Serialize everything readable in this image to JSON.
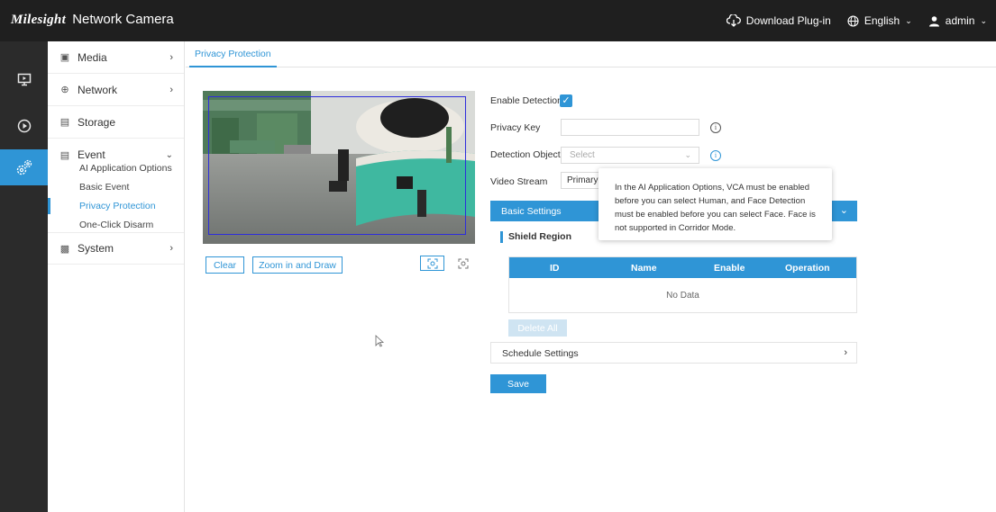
{
  "header": {
    "brand": "Milesight",
    "product": "Network Camera",
    "download_label": "Download Plug-in",
    "language": "English",
    "user": "admin"
  },
  "rail": [
    {
      "icon": "live-view-icon"
    },
    {
      "icon": "playback-icon"
    },
    {
      "icon": "settings-icon",
      "active": true
    }
  ],
  "sidebar": {
    "items": [
      {
        "label": "Media",
        "icon": "media-icon"
      },
      {
        "label": "Network",
        "icon": "globe-icon"
      },
      {
        "label": "Storage",
        "icon": "storage-icon"
      },
      {
        "label": "Event",
        "icon": "event-icon"
      },
      {
        "label": "System",
        "icon": "system-icon"
      }
    ],
    "event_sub": [
      "AI Application Options",
      "Basic Event",
      "Privacy Protection",
      "One-Click Disarm"
    ],
    "active_sub": "Privacy Protection"
  },
  "tab": "Privacy Protection",
  "preview": {
    "buttons": {
      "clear": "Clear",
      "zoom": "Zoom in and Draw"
    }
  },
  "form": {
    "enable_detection": "Enable Detection",
    "enable_checked": true,
    "privacy_key": "Privacy Key",
    "privacy_key_value": "",
    "detection_object": "Detection Object",
    "detection_placeholder": "Select",
    "video_stream": "Video Stream",
    "video_stream_value": "Primary Stream"
  },
  "tooltip": "In the AI Application Options, VCA must be enabled before you can select Human, and Face Detection must be enabled before you can select Face. Face is not supported in Corridor Mode.",
  "basic_settings": "Basic Settings",
  "shield_region": "Shield Region",
  "table": {
    "columns": [
      "ID",
      "Name",
      "Enable",
      "Operation"
    ],
    "empty": "No Data"
  },
  "delete_all": "Delete All",
  "schedule_settings": "Schedule Settings",
  "save": "Save",
  "colors": {
    "accent": "#2f95d6",
    "topbar": "#1f1f1f",
    "rail": "#2b2b2b"
  }
}
